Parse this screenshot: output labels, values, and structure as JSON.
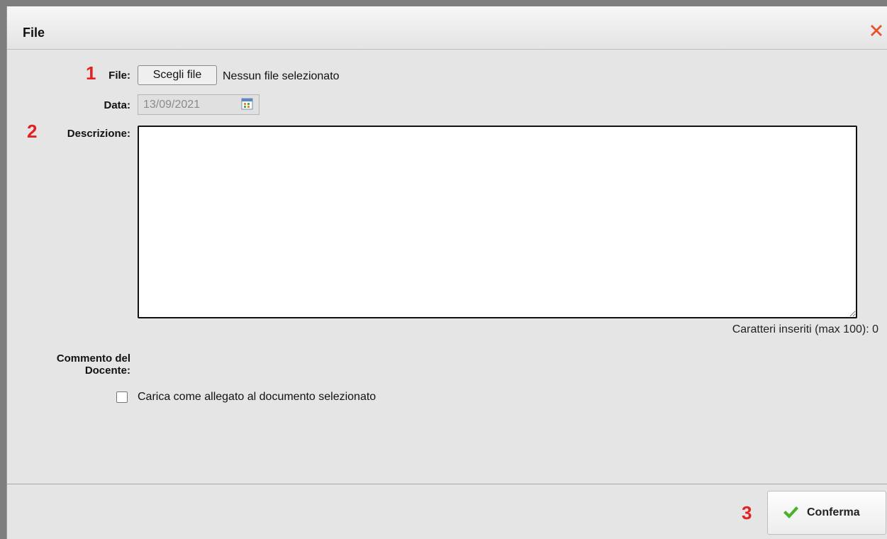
{
  "dialog": {
    "title": "File",
    "close_icon": "close-x-icon",
    "close_color": "#e8532e"
  },
  "form": {
    "marker_1": "1",
    "marker_2": "2",
    "marker_3": "3",
    "file_label": "File:",
    "file_button": "Scegli file",
    "file_status": "Nessun file selezionato",
    "date_label": "Data:",
    "date_value": "13/09/2021",
    "calendar_icon": "calendar-icon",
    "description_label": "Descrizione:",
    "description_value": "",
    "char_counter": "Caratteri inseriti (max 100): 0",
    "comment_label_line1": "Commento del",
    "comment_label_line2": "Docente:",
    "attach_checkbox_label": "Carica come allegato al documento selezionato",
    "attach_checked": false
  },
  "footer": {
    "confirm_label": "Conferma",
    "confirm_icon": "check-icon",
    "marker_color": "#e22222"
  }
}
